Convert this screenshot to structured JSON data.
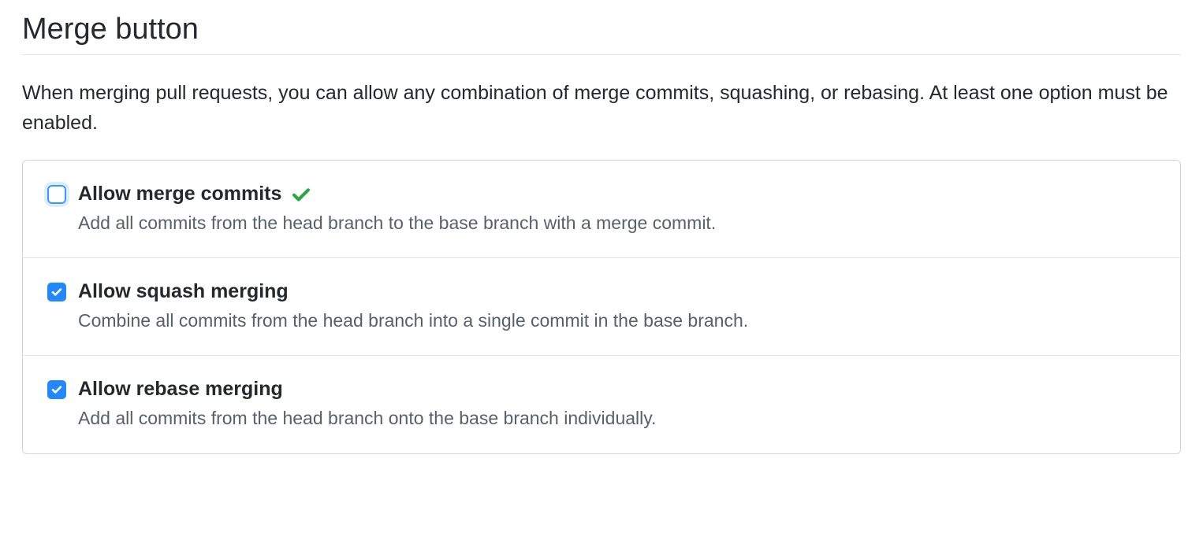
{
  "section": {
    "title": "Merge button",
    "description": "When merging pull requests, you can allow any combination of merge commits, squashing, or rebasing. At least one option must be enabled."
  },
  "options": [
    {
      "key": "merge-commits",
      "title": "Allow merge commits",
      "description": "Add all commits from the head branch to the base branch with a merge commit.",
      "checked": false,
      "saved_indicator": true
    },
    {
      "key": "squash-merging",
      "title": "Allow squash merging",
      "description": "Combine all commits from the head branch into a single commit in the base branch.",
      "checked": true,
      "saved_indicator": false
    },
    {
      "key": "rebase-merging",
      "title": "Allow rebase merging",
      "description": "Add all commits from the head branch onto the base branch individually.",
      "checked": true,
      "saved_indicator": false
    }
  ],
  "colors": {
    "accent": "#2188ff",
    "success": "#28a745",
    "border": "#e1e4e8",
    "muted": "#586069"
  }
}
